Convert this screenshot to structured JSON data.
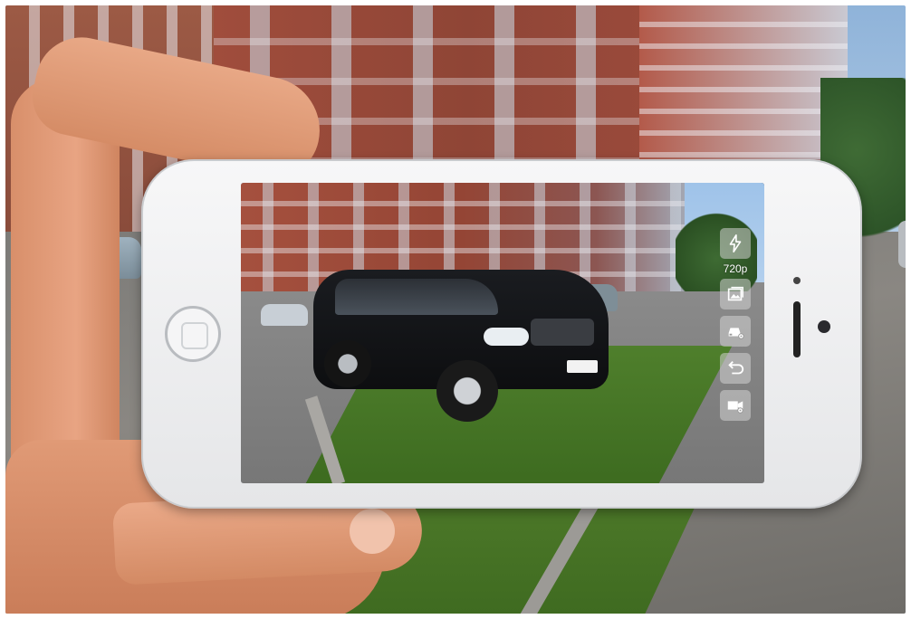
{
  "camera_app": {
    "resolution_label": "720p",
    "controls": [
      {
        "icon": "flash-icon"
      },
      {
        "icon": "resolution-icon"
      },
      {
        "icon": "gallery-icon"
      },
      {
        "icon": "car-settings-icon"
      },
      {
        "icon": "rotate-icon"
      },
      {
        "icon": "video-settings-icon"
      }
    ]
  },
  "colors": {
    "control_bg": "#d2d2d2",
    "phone_body": "#f0f0f2"
  }
}
